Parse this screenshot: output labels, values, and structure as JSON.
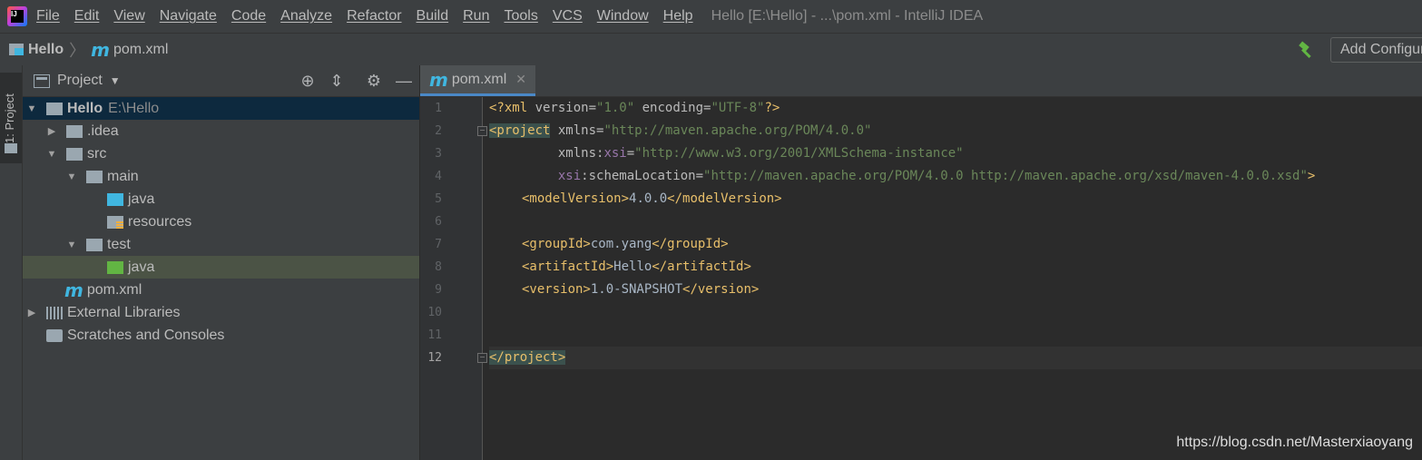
{
  "menubar": {
    "items": [
      "File",
      "Edit",
      "View",
      "Navigate",
      "Code",
      "Analyze",
      "Refactor",
      "Build",
      "Run",
      "Tools",
      "VCS",
      "Window",
      "Help"
    ],
    "window_title": "Hello [E:\\Hello] - ...\\pom.xml - IntelliJ IDEA"
  },
  "navbar": {
    "project": "Hello",
    "file": "pom.xml",
    "run_config": "Add Configuration..."
  },
  "left_toolbar": {
    "tab_label": "1: Project"
  },
  "project_panel": {
    "title": "Project",
    "root_name": "Hello",
    "root_path": "E:\\Hello",
    "tree": [
      ".idea",
      "src",
      "main",
      "java",
      "resources",
      "test",
      "java",
      "pom.xml",
      "External Libraries",
      "Scratches and Consoles"
    ]
  },
  "editor": {
    "tab_label": "pom.xml",
    "line_numbers": [
      "1",
      "2",
      "3",
      "4",
      "5",
      "6",
      "7",
      "8",
      "9",
      "10",
      "11",
      "12"
    ],
    "lines": {
      "l1_decl_open": "<?xml ",
      "l1_version_attr": "version=",
      "l1_version_val": "\"1.0\"",
      "l1_encoding_attr": " encoding=",
      "l1_encoding_val": "\"UTF-8\"",
      "l1_decl_close": "?>",
      "l2_project_tag": "<project",
      "l2_xmlns_attr": " xmlns=",
      "l2_xmlns_val": "\"http://maven.apache.org/POM/4.0.0\"",
      "l3_indent": "         xmlns:",
      "l3_ns": "xsi",
      "l3_eq": "=",
      "l3_val": "\"http://www.w3.org/2001/XMLSchema-instance\"",
      "l4_indent": "         ",
      "l4_ns": "xsi",
      "l4_attr": ":schemaLocation=",
      "l4_val": "\"http://maven.apache.org/POM/4.0.0 http://maven.apache.org/xsd/maven-4.0.0.xsd\"",
      "l4_close": ">",
      "model_open": "<modelVersion>",
      "model_text": "4.0.0",
      "model_close": "</modelVersion>",
      "group_open": "<groupId>",
      "group_text": "com.yang",
      "group_close": "</groupId>",
      "artifact_open": "<artifactId>",
      "artifact_text": "Hello",
      "artifact_close": "</artifactId>",
      "version_open": "<version>",
      "version_text": "1.0-SNAPSHOT",
      "version_close": "</version>",
      "project_close": "</project>"
    }
  },
  "watermark": "https://blog.csdn.net/Masterxiaoyang",
  "colors": {
    "tag": "#e8bf6a",
    "string": "#6a8759",
    "namespace": "#9876aa",
    "text": "#a9b7c6",
    "selection": "#0d293e"
  }
}
